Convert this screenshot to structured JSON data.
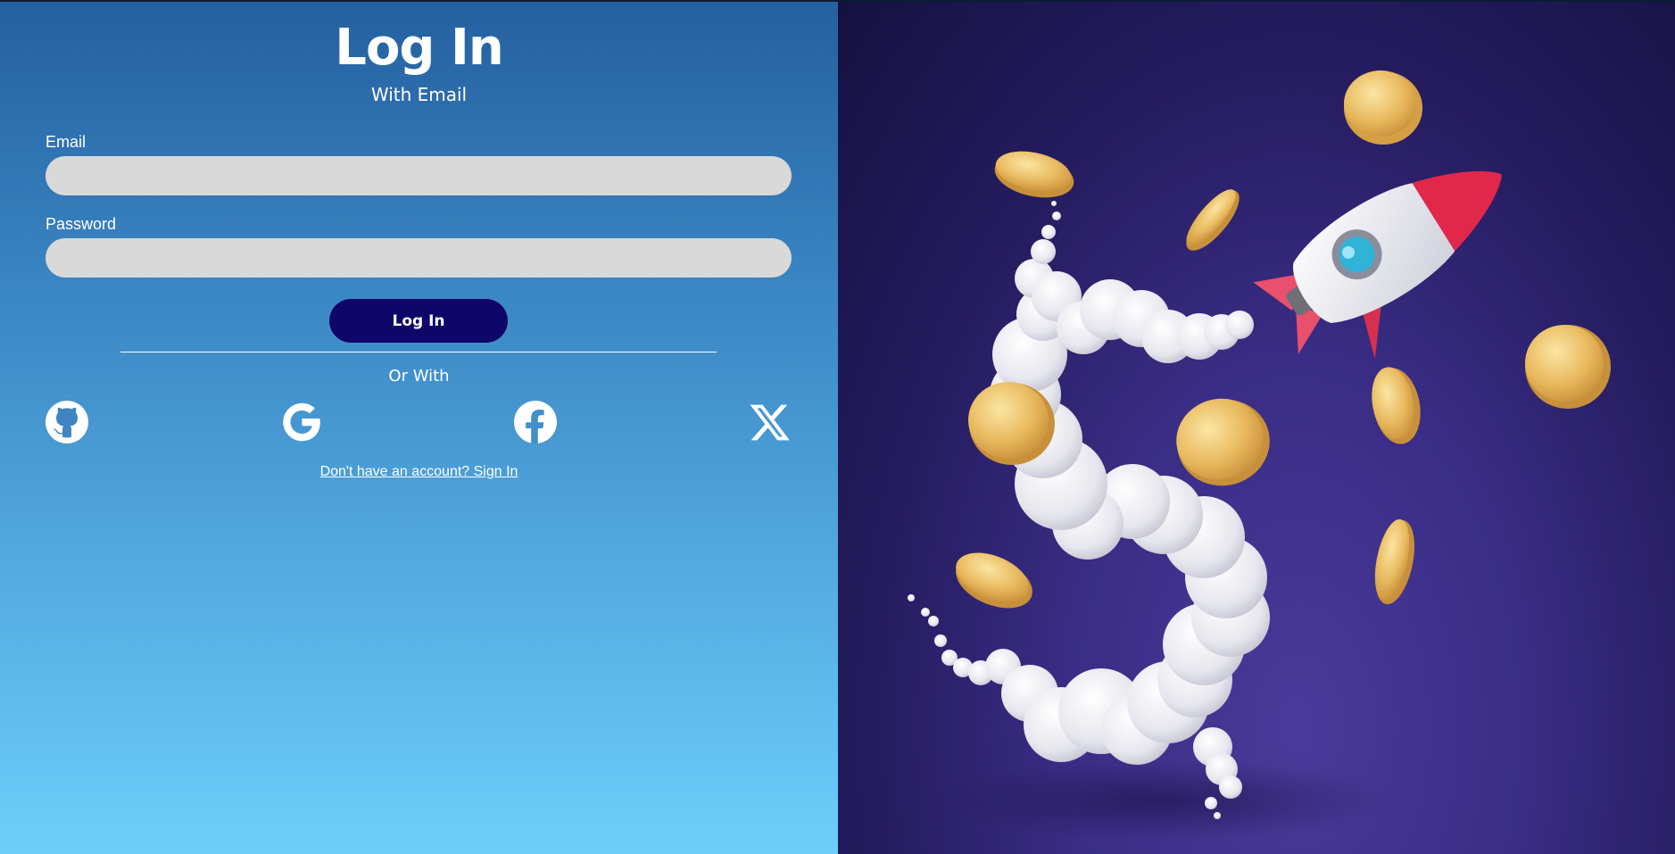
{
  "header": {
    "title": "Log In",
    "subtitle": "With Email"
  },
  "form": {
    "email_label": "Email",
    "email_value": "",
    "password_label": "Password",
    "password_value": "",
    "submit_label": "Log In"
  },
  "social": {
    "divider_text": "Or With",
    "providers": [
      "github-icon",
      "google-icon",
      "facebook-icon",
      "x-icon"
    ]
  },
  "footer": {
    "signup_link": "Don't have an account? Sign In"
  },
  "colors": {
    "gradient_top": "#2560a0",
    "gradient_bottom": "#6dcff9",
    "button_bg": "#0e0668",
    "input_bg": "#d9d9d9",
    "illustration_bg": "#2b2170"
  },
  "illustration": {
    "icon": "rocket-coins-illustration"
  }
}
